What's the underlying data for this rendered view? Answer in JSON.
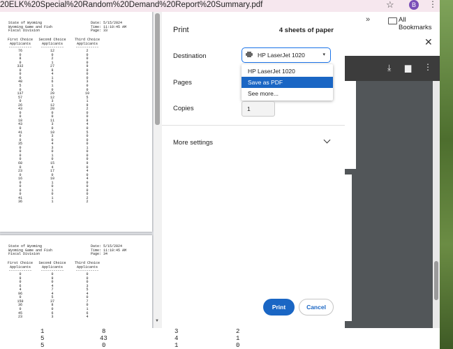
{
  "browser": {
    "url_fragment": "20ELK%20Special%20Random%20Demand%20Report%20Summary.pdf",
    "avatar_letter": "B",
    "all_bookmarks": "All Bookmarks"
  },
  "preview": {
    "pages": [
      {
        "header_left": [
          "State of Wyoming",
          "Wyoming Game and Fish",
          "Fiscal Division"
        ],
        "header_right": [
          "Date: 5/15/2024",
          "Time: 11:10:45 AM",
          "Page: 33"
        ],
        "col_titles": [
          [
            "First Choice",
            "Applicants"
          ],
          [
            "Second Choice",
            "Applicants"
          ],
          [
            "Third Choice",
            "Applicants"
          ]
        ],
        "rows": [
          [
            76,
            12,
            2
          ],
          [
            0,
            0,
            0
          ],
          [
            8,
            2,
            0
          ],
          [
            0,
            1,
            0
          ],
          [
            332,
            27,
            9
          ],
          [
            0,
            8,
            0
          ],
          [
            0,
            4,
            0
          ],
          [
            0,
            1,
            0
          ],
          [
            48,
            6,
            3
          ],
          [
            5,
            1,
            0
          ],
          [
            0,
            0,
            0
          ],
          [
            137,
            20,
            10
          ],
          [
            57,
            12,
            5
          ],
          [
            0,
            3,
            1
          ],
          [
            26,
            12,
            9
          ],
          [
            43,
            20,
            2
          ],
          [
            0,
            0,
            0
          ],
          [
            0,
            0,
            0
          ],
          [
            18,
            11,
            8
          ],
          [
            43,
            3,
            4
          ],
          [
            0,
            0,
            0
          ],
          [
            41,
            10,
            5
          ],
          [
            0,
            3,
            0
          ],
          [
            0,
            0,
            0
          ],
          [
            35,
            4,
            0
          ],
          [
            0,
            3,
            1
          ],
          [
            0,
            0,
            0
          ],
          [
            0,
            1,
            0
          ],
          [
            0,
            0,
            0
          ],
          [
            68,
            15,
            9
          ],
          [
            0,
            4,
            0
          ],
          [
            23,
            17,
            4
          ],
          [
            0,
            0,
            0
          ],
          [
            16,
            10,
            4
          ],
          [
            0,
            1,
            0
          ],
          [
            0,
            0,
            0
          ],
          [
            0,
            1,
            0
          ],
          [
            0,
            0,
            0
          ],
          [
            41,
            1,
            2
          ],
          [
            36,
            1,
            2
          ]
        ]
      },
      {
        "header_left": [
          "State of Wyoming",
          "Wyoming Game and Fish",
          "Fiscal Division"
        ],
        "header_right": [
          "Date: 5/15/2024",
          "Time: 11:10:45 AM",
          "Page: 34"
        ],
        "col_titles": [
          [
            "First Choice",
            "Applicants"
          ],
          [
            "Second Choice",
            "Applicants"
          ],
          [
            "Third Choice",
            "Applicants"
          ]
        ],
        "rows": [
          [
            0,
            0,
            0
          ],
          [
            9,
            9,
            0
          ],
          [
            0,
            0,
            0
          ],
          [
            6,
            4,
            3
          ],
          [
            4,
            7,
            5
          ],
          [
            96,
            4,
            4
          ],
          [
            0,
            5,
            0
          ],
          [
            150,
            37,
            7
          ],
          [
            36,
            8,
            0
          ],
          [
            0,
            0,
            1
          ],
          [
            45,
            6,
            6
          ],
          [
            23,
            3,
            4
          ]
        ]
      }
    ]
  },
  "dialog": {
    "title": "Print",
    "sheets": "4 sheets of paper",
    "destination_label": "Destination",
    "destination_value": "HP LaserJet 1020",
    "dropdown_options": [
      "HP LaserJet 1020",
      "Save as PDF",
      "See more..."
    ],
    "selected_index": 1,
    "pages_label": "Pages",
    "copies_label": "Copies",
    "copies_value": "1",
    "more_settings": "More settings",
    "print_button": "Print",
    "cancel_button": "Cancel"
  },
  "background_doc": {
    "rows": [
      [
        "1",
        "8",
        "3",
        "2"
      ],
      [
        "5",
        "43",
        "4",
        "1"
      ],
      [
        "5",
        "0",
        "1",
        "0"
      ]
    ]
  },
  "colors": {
    "accent": "#1a73e8",
    "selected": "#1a66c4",
    "titlebar": "#f6e7ee"
  }
}
